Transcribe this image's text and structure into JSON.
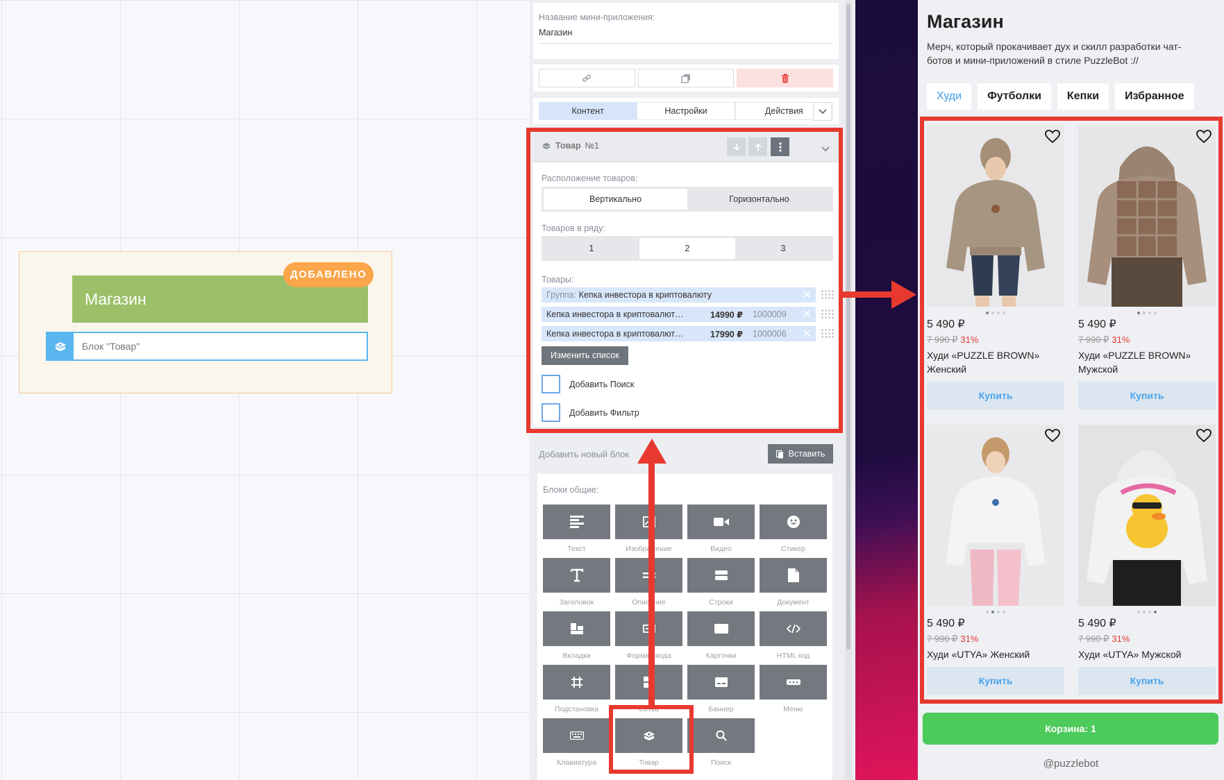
{
  "canvas": {
    "node_title": "Магазин",
    "node_badge": "ДОБАВЛЕНО",
    "node_block_label": "Блок \"Товар\"",
    "node_block_icon": "product-box-icon"
  },
  "editor": {
    "appname_label": "Название мини-приложения:",
    "appname_value": "Магазин",
    "actions": {
      "link_icon": "link-icon",
      "copy_icon": "copy-icon",
      "delete_icon": "trash-icon",
      "delete_color": "#e53935"
    },
    "tabs": [
      "Контент",
      "Настройки",
      "Действия"
    ],
    "active_tab": "Контент",
    "product_block": {
      "title": "Товар",
      "number": "№1",
      "layout_label": "Расположение товаров:",
      "layout_options": [
        "Вертикально",
        "Горизонтально"
      ],
      "layout_selected": "Вертикально",
      "per_row_label": "Товаров в ряду:",
      "per_row_options": [
        "1",
        "2",
        "3"
      ],
      "per_row_selected": "2",
      "items_label": "Товары:",
      "items": [
        {
          "prefix": "Группа:",
          "name": "Кепка инвестора в криптовалюту",
          "price": "",
          "sku": ""
        },
        {
          "prefix": "",
          "name": "Кепка инвестора в криптовалют…",
          "price": "14990 ₽",
          "sku": "1000009"
        },
        {
          "prefix": "",
          "name": "Кепка инвестора в криптовалют…",
          "price": "17990 ₽",
          "sku": "1000006"
        }
      ],
      "change_list_button": "Изменить список",
      "add_search_label": "Добавить Поиск",
      "add_filter_label": "Добавить Фильтр"
    },
    "add_block_label": "Добавить новый блок",
    "paste_button": "Вставить",
    "blocks_label": "Блоки общие:",
    "blocks": [
      {
        "label": "Текст",
        "icon": "text-align-icon"
      },
      {
        "label": "Изображение",
        "icon": "image-icon"
      },
      {
        "label": "Видео",
        "icon": "video-icon"
      },
      {
        "label": "Стикер",
        "icon": "sticker-icon"
      },
      {
        "label": "Заголовок",
        "icon": "heading-icon"
      },
      {
        "label": "Описание",
        "icon": "description-icon"
      },
      {
        "label": "Строки",
        "icon": "rows-icon"
      },
      {
        "label": "Документ",
        "icon": "document-icon"
      },
      {
        "label": "Вкладки",
        "icon": "tabs-icon"
      },
      {
        "label": "Форма ввода",
        "icon": "form-icon"
      },
      {
        "label": "Карточки",
        "icon": "cards-icon"
      },
      {
        "label": "HTML код",
        "icon": "code-icon"
      },
      {
        "label": "Подстановка",
        "icon": "substitution-icon"
      },
      {
        "label": "Сетка",
        "icon": "grid-icon"
      },
      {
        "label": "Баннер",
        "icon": "banner-icon"
      },
      {
        "label": "Меню",
        "icon": "menu-icon"
      },
      {
        "label": "Клавиатура",
        "icon": "keyboard-icon"
      },
      {
        "label": "Товар",
        "icon": "product-box-icon"
      },
      {
        "label": "Поиск",
        "icon": "search-icon"
      }
    ]
  },
  "preview": {
    "title": "Магазин",
    "description": "Мерч, который прокачивает дух и скилл разработки чат-ботов и мини-приложений в стиле PuzzleBot ://",
    "chips": [
      "Худи",
      "Футболки",
      "Кепки",
      "Избранное"
    ],
    "active_chip": "Худи",
    "products": [
      {
        "price": "5 490 ₽",
        "old_price": "7 990 ₽",
        "discount": "31%",
        "name": "Худи «PUZZLE BROWN» Женский",
        "buy": "Купить",
        "image": "beige-hoodie-woman-front",
        "slide": 1
      },
      {
        "price": "5 490 ₽",
        "old_price": "7 990 ₽",
        "discount": "31%",
        "name": "Худи «PUZZLE BROWN» Мужской",
        "buy": "Купить",
        "image": "beige-hoodie-back-print",
        "slide": 1
      },
      {
        "price": "5 490 ₽",
        "old_price": "7 990 ₽",
        "discount": "31%",
        "name": "Худи «UTYA» Женский",
        "buy": "Купить",
        "image": "white-hoodie-woman-front",
        "slide": 2
      },
      {
        "price": "5 490 ₽",
        "old_price": "7 990 ₽",
        "discount": "31%",
        "name": "Худи «UTYA» Мужской",
        "buy": "Купить",
        "image": "white-hoodie-duck-back",
        "slide": 4
      }
    ],
    "cart_button": "Корзина: 1",
    "footer_handle": "@puzzlebot"
  },
  "colors": {
    "highlight": "#e8392f",
    "accent_blue": "#3f9be8",
    "cart_green": "#4cca5a",
    "node_green": "#9cc06a",
    "badge_orange": "#fba64a"
  }
}
